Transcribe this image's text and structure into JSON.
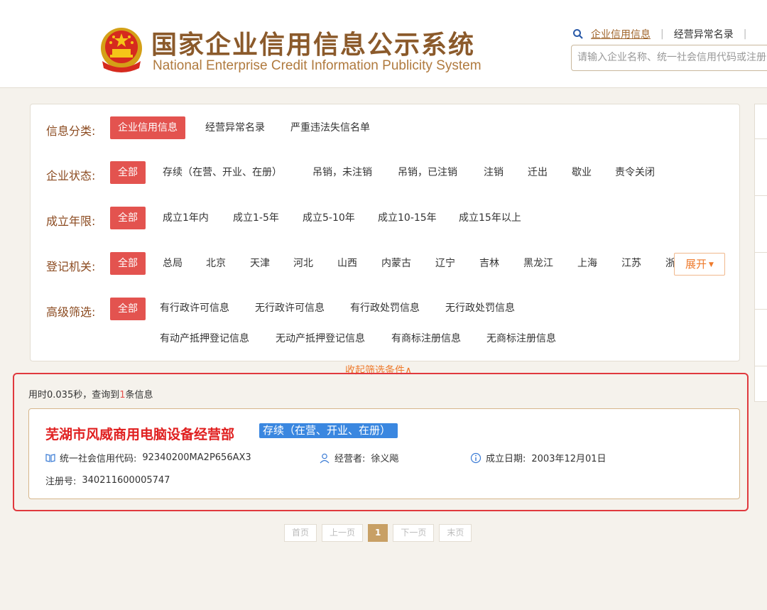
{
  "header": {
    "title_cn": "国家企业信用信息公示系统",
    "title_en": "National Enterprise Credit Information Publicity System",
    "nav_active": "企业信用信息",
    "nav_sep": "|",
    "nav_abnormal": "经营异常名录",
    "nav_sep2": "|",
    "search_placeholder": "请输入企业名称、统一社会信用代码或注册号"
  },
  "filters": {
    "category": {
      "label": "信息分类:",
      "selected": "企业信用信息",
      "options": [
        "经营异常名录",
        "严重违法失信名单"
      ]
    },
    "status": {
      "label": "企业状态:",
      "selected": "全部",
      "options": [
        "存续（在营、开业、在册）",
        "吊销，未注销",
        "吊销，已注销",
        "注销",
        "迁出",
        "歇业",
        "责令关闭"
      ]
    },
    "years": {
      "label": "成立年限:",
      "selected": "全部",
      "options": [
        "成立1年内",
        "成立1-5年",
        "成立5-10年",
        "成立10-15年",
        "成立15年以上"
      ]
    },
    "authority": {
      "label": "登记机关:",
      "selected": "全部",
      "options": [
        "总局",
        "北京",
        "天津",
        "河北",
        "山西",
        "内蒙古",
        "辽宁",
        "吉林",
        "黑龙江",
        "上海",
        "江苏",
        "浙江"
      ],
      "expand_label": "展开"
    },
    "advanced": {
      "label": "高级筛选:",
      "selected": "全部",
      "options_row1": [
        "有行政许可信息",
        "无行政许可信息",
        "有行政处罚信息",
        "无行政处罚信息"
      ],
      "options_row2": [
        "有动产抵押登记信息",
        "无动产抵押登记信息",
        "有商标注册信息",
        "无商标注册信息"
      ]
    },
    "collapse_label": "收起筛选条件∧"
  },
  "results": {
    "stats_prefix": "用时0.035秒，查询到",
    "count": "1",
    "stats_suffix": "条信息",
    "items": [
      {
        "name": "芜湖市风威商用电脑设备经营部",
        "status": "存续（在营、开业、在册）",
        "credit_code_label": "统一社会信用代码:",
        "credit_code": "92340200MA2P656AX3",
        "operator_label": "经营者:",
        "operator": "徐义飚",
        "founded_label": "成立日期:",
        "founded": "2003年12月01日",
        "reg_no_label": "注册号:",
        "reg_no": "340211600005747"
      }
    ]
  },
  "pagination": {
    "first": "首页",
    "prev": "上一页",
    "current": "1",
    "next": "下一页",
    "last": "末页"
  },
  "colors": {
    "accent_red": "#e3534f",
    "brand_brown": "#8b5a2b",
    "status_blue": "#3a87e0",
    "highlight_orange": "#ee7a2c"
  }
}
